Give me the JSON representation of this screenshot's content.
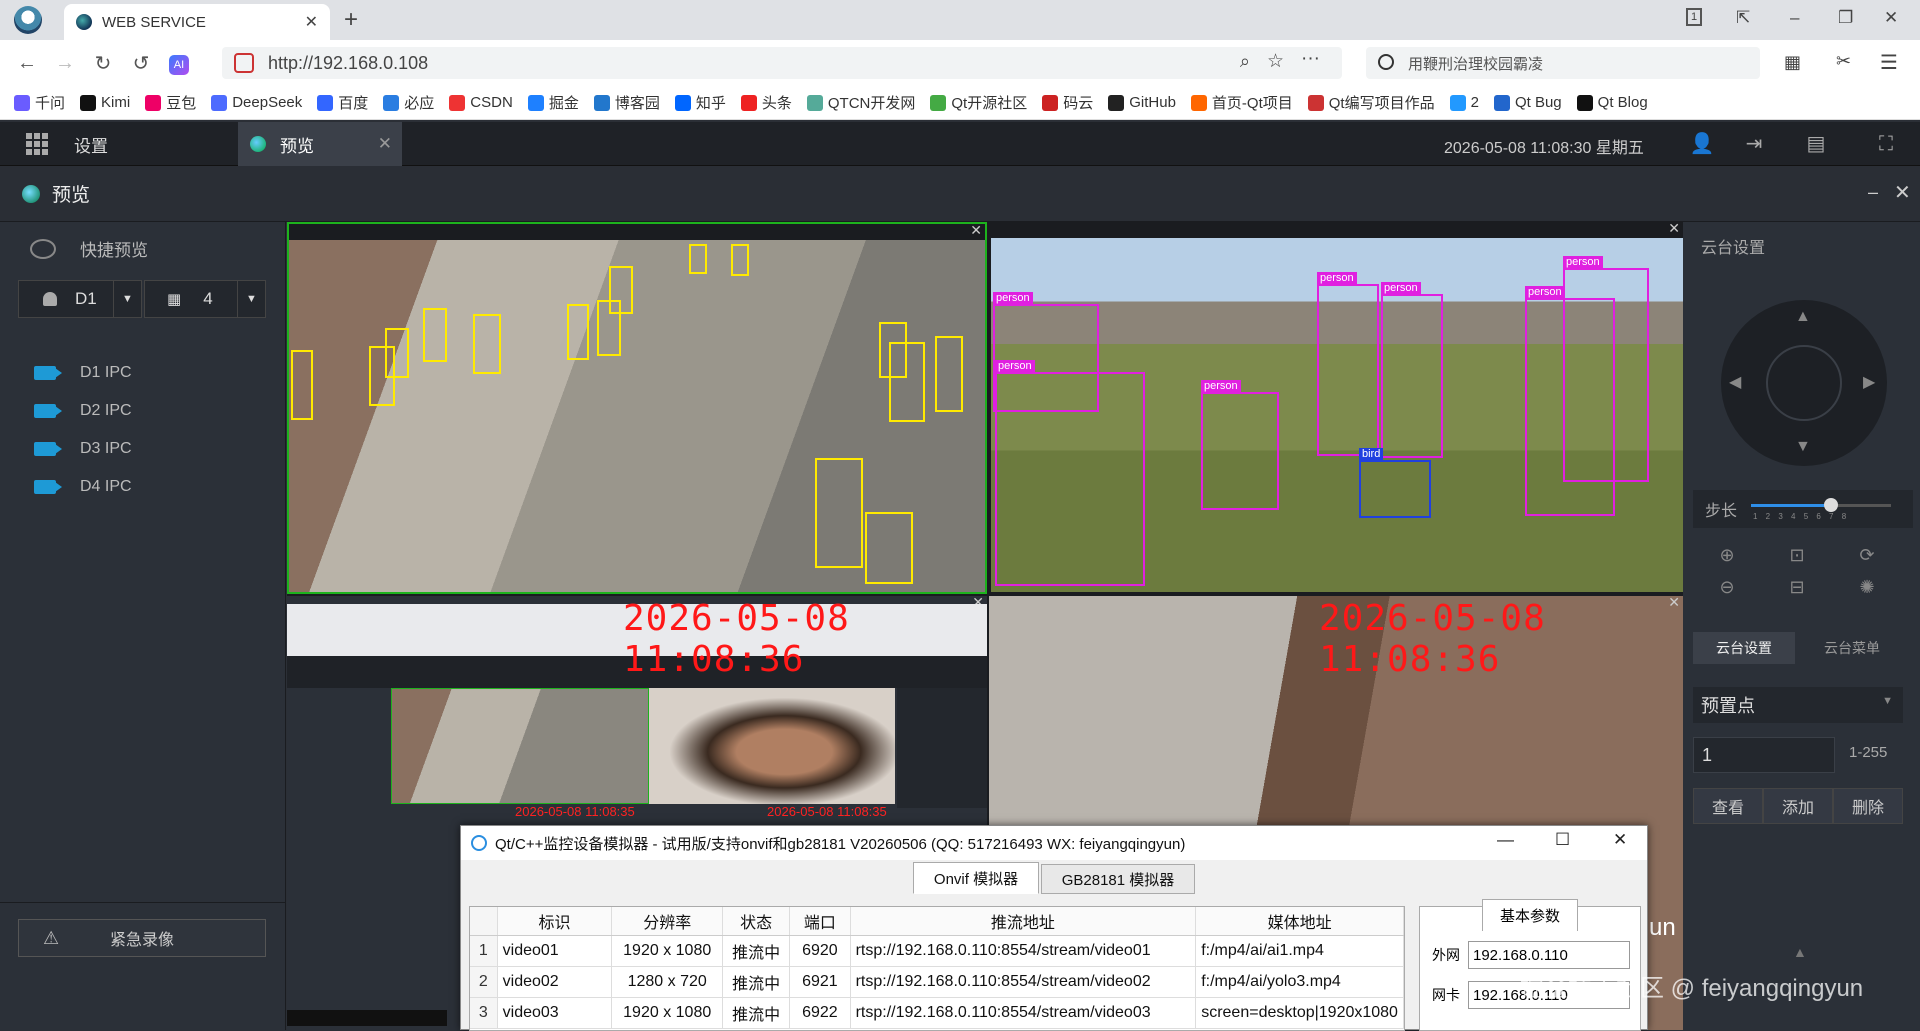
{
  "browser": {
    "tab_title": "WEB SERVICE",
    "url": "http://192.168.0.108",
    "search_text": "用鞭刑治理校园霸凌",
    "bookmarks": [
      "千问",
      "Kimi",
      "豆包",
      "DeepSeek",
      "百度",
      "必应",
      "CSDN",
      "掘金",
      "博客园",
      "知乎",
      "头条",
      "QTCN开发网",
      "Qt开源社区",
      "码云",
      "GitHub",
      "首页-Qt项目",
      "Qt编写项目作品",
      "2",
      "Qt Bug",
      "Qt Blog"
    ]
  },
  "app": {
    "settings_label": "设置",
    "tab_label": "预览",
    "datetime": "2026-05-08 11:08:30 星期五",
    "page_title": "预览"
  },
  "left": {
    "quick_preview": "快捷预览",
    "channel_select": "D1",
    "layout_select": "4",
    "devices": [
      "D1 IPC",
      "D2 IPC",
      "D3 IPC",
      "D4 IPC"
    ],
    "emergency": "紧急录像"
  },
  "video": {
    "osd_time_3": "2026-05-08 11:08:36",
    "osd_time_4": "2026-05-08 11:08:36",
    "person_label": "person",
    "bird_label": "bird",
    "nested_osd_1": "2026-05-08 11:08:35",
    "nested_osd_2": "2026-05-08 11:08:35",
    "side_text": "un"
  },
  "dialog": {
    "title": "Qt/C++监控设备模拟器 - 试用版/支持onvif和gb28181 V20260506 (QQ: 517216493 WX: feiyangqingyun)",
    "tab_onvif": "Onvif 模拟器",
    "tab_gb": "GB28181 模拟器",
    "columns": [
      "标识",
      "分辨率",
      "状态",
      "端口",
      "推流地址",
      "媒体地址"
    ],
    "rows": [
      {
        "n": "1",
        "id": "video01",
        "res": "1920 x 1080",
        "status": "推流中",
        "port": "6920",
        "push": "rtsp://192.168.0.110:8554/stream/video01",
        "media": "f:/mp4/ai/ai1.mp4"
      },
      {
        "n": "2",
        "id": "video02",
        "res": "1280 x 720",
        "status": "推流中",
        "port": "6921",
        "push": "rtsp://192.168.0.110:8554/stream/video02",
        "media": "f:/mp4/ai/yolo3.mp4"
      },
      {
        "n": "3",
        "id": "video03",
        "res": "1920 x 1080",
        "status": "推流中",
        "port": "6922",
        "push": "rtsp://192.168.0.110:8554/stream/video03",
        "media": "screen=desktop|1920x1080"
      }
    ],
    "params_tab": "基本参数",
    "wan_label": "外网",
    "wan_value": "192.168.0.110",
    "nic_label": "网卡",
    "nic_value": "192.168.0.110"
  },
  "right": {
    "ptz_title": "云台设置",
    "step_label": "步长",
    "step_ticks": "1 2 3 4 5 6 7 8",
    "step_value": 5,
    "step_max": 8,
    "tab_ptz": "云台设置",
    "tab_menu": "云台菜单",
    "preset_label": "预置点",
    "preset_value": "1",
    "preset_range": "1-255",
    "btn_view": "查看",
    "btn_add": "添加",
    "btn_delete": "删除"
  },
  "watermark": "掘金技术社区 @ feiyangqingyun"
}
